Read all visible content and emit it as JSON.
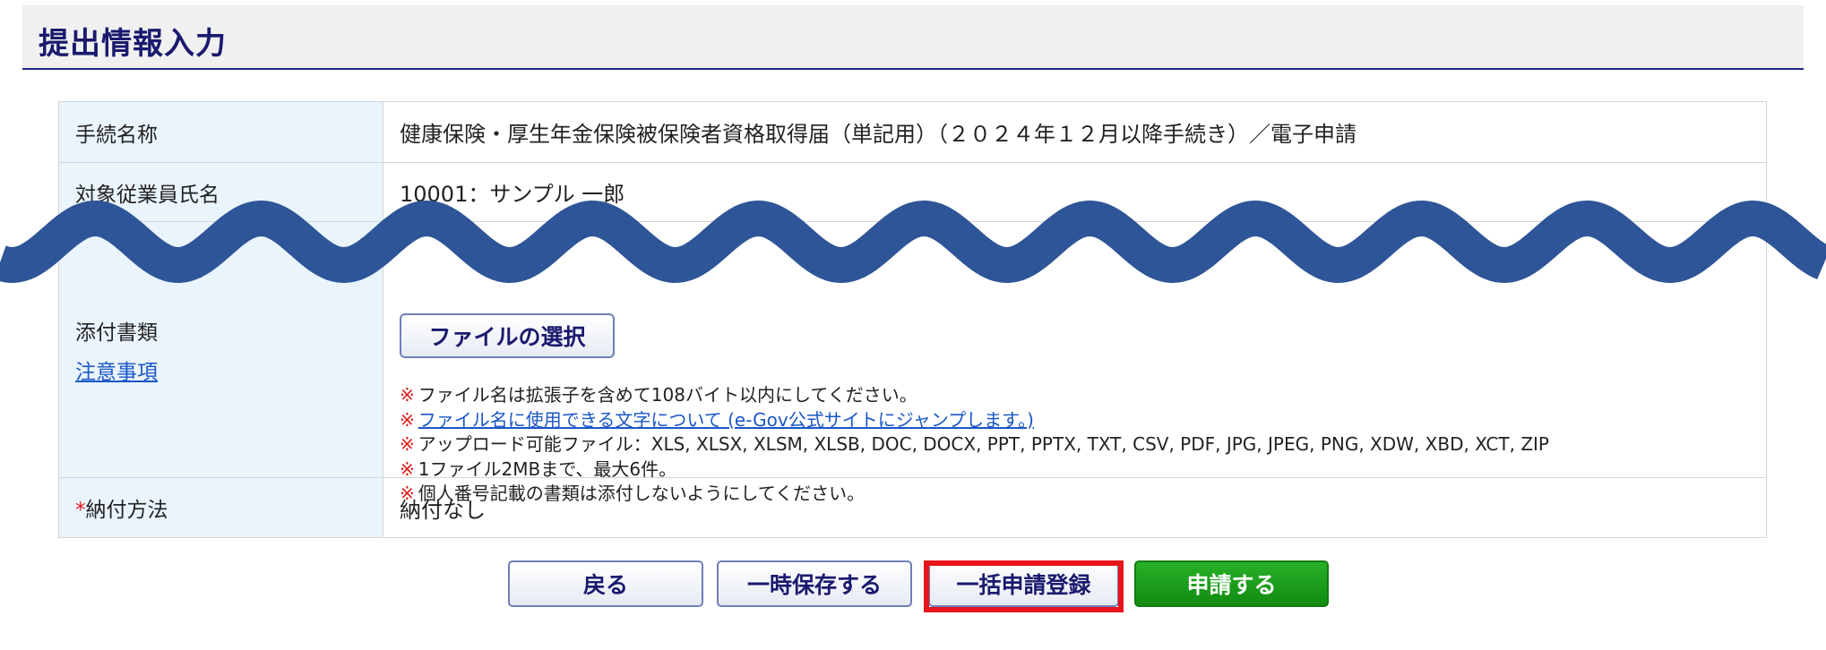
{
  "header": {
    "title": "提出情報入力"
  },
  "form": {
    "procedure": {
      "label": "手続名称",
      "value": "健康保険・厚生年金保険被保険者資格取得届（単記用）（２０２４年１２月以降手続き）／電子申請"
    },
    "employee": {
      "label": "対象従業員氏名",
      "value": "10001：サンプル 一郎"
    },
    "attachment": {
      "label": "添付書類",
      "notes_link": "注意事項",
      "file_button": "ファイルの選択",
      "note_mark": "※",
      "notes": [
        "ファイル名は拡張子を含めて108バイト以内にしてください。",
        "ファイル名に使用できる文字について (e-Gov公式サイトにジャンプします。)",
        "アップロード可能ファイル：XLS, XLSX, XLSM, XLSB, DOC, DOCX, PPT, PPTX, TXT, CSV, PDF, JPG, JPEG, PNG, XDW, XBD, XCT, ZIP",
        "1ファイル2MBまで、最大6件。",
        "個人番号記載の書類は添付しないようにしてください。"
      ]
    },
    "payment": {
      "required_mark": "*",
      "label": "納付方法",
      "value": "納付なし"
    }
  },
  "buttons": {
    "back": "戻る",
    "save_draft": "一時保存する",
    "bulk_register": "一括申請登録",
    "submit": "申請する"
  },
  "colors": {
    "title": "#1a1a6e",
    "label_bg": "#eaf4fc",
    "link": "#1a56c6",
    "note_mark": "#e01b1b",
    "primary_button": "#1a9a1a",
    "highlight": "#e8141c",
    "wave": "#2e5597"
  }
}
